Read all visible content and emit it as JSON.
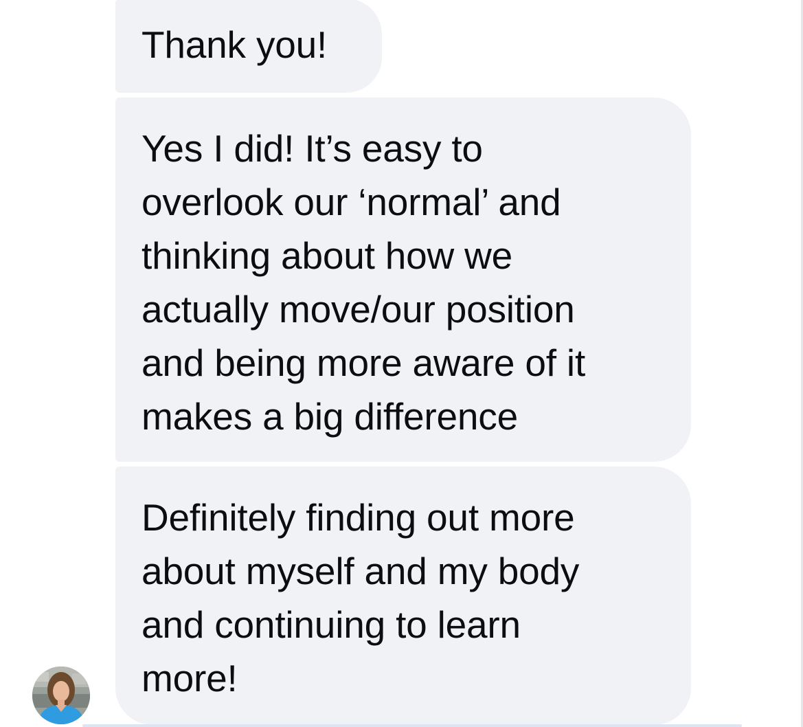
{
  "messages": [
    {
      "text": "Thank you!"
    },
    {
      "text": "Yes I did! It’s easy to\noverlook our ‘normal’ and\nthinking about how we\nactually move/our position\nand being more aware of it\nmakes a big difference"
    },
    {
      "text": "Definitely finding out more\nabout myself and my body\nand continuing to learn\nmore!"
    }
  ],
  "colors": {
    "bubble_background": "#f1f2f5",
    "text": "#0c0d10",
    "avatar_shirt": "#2f9be0"
  },
  "icons": {
    "avatar": "user-avatar-photo"
  }
}
